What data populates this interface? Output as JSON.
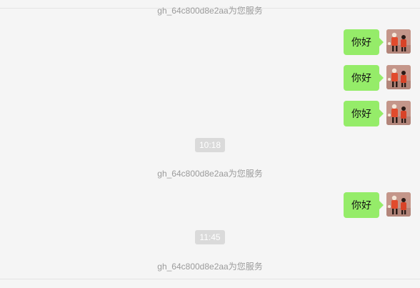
{
  "service_notice": "gh_64c800d8e2aa为您服务",
  "messages": [
    {
      "sender": "self",
      "text": "你好"
    },
    {
      "sender": "self",
      "text": "你好"
    },
    {
      "sender": "self",
      "text": "你好"
    },
    {
      "sender": "self",
      "text": "你好"
    }
  ],
  "timestamps": [
    "10:18",
    "11:45"
  ],
  "colors": {
    "background": "#f5f5f5",
    "bubble_self": "#95ec69",
    "timestamp_chip": "#dadada",
    "system_text": "#9b9b9b"
  },
  "icons": {
    "avatar": "avatar-illustration-icon"
  }
}
